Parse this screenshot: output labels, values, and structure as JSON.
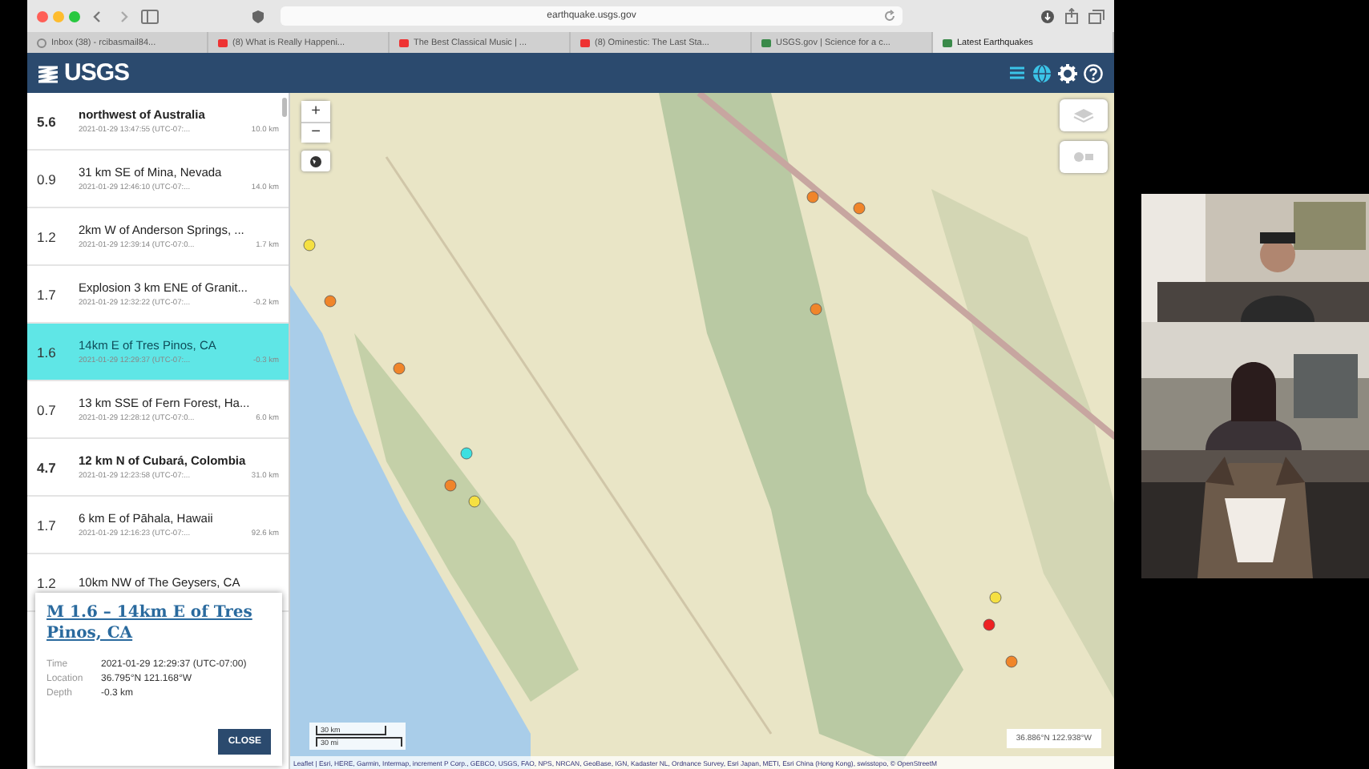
{
  "browser": {
    "address": "earthquake.usgs.gov",
    "tabs": [
      {
        "label": "Inbox (38) - rcibasmail84...",
        "selected": false
      },
      {
        "label": "(8) What is Really Happeni...",
        "selected": false
      },
      {
        "label": "The Best Classical Music | ...",
        "selected": false
      },
      {
        "label": "(8) Ominestic: The Last Sta...",
        "selected": false
      },
      {
        "label": "USGS.gov | Science for a c...",
        "selected": false
      },
      {
        "label": "Latest Earthquakes",
        "selected": true
      }
    ]
  },
  "header": {
    "logo": "USGS"
  },
  "earthquakes": [
    {
      "magnitude": "5.6",
      "title": "northwest of Australia",
      "time": "2021-01-29 13:47:55 (UTC-07:...",
      "depth": "10.0 km",
      "significant": true,
      "selected": false
    },
    {
      "magnitude": "0.9",
      "title": "31 km SE of Mina, Nevada",
      "time": "2021-01-29 12:46:10 (UTC-07:...",
      "depth": "14.0 km",
      "significant": false,
      "selected": false
    },
    {
      "magnitude": "1.2",
      "title": "2km W of Anderson Springs, ...",
      "time": "2021-01-29 12:39:14 (UTC-07:0...",
      "depth": "1.7 km",
      "significant": false,
      "selected": false
    },
    {
      "magnitude": "1.7",
      "title": "Explosion 3 km ENE of Granit...",
      "time": "2021-01-29 12:32:22 (UTC-07:...",
      "depth": "-0.2 km",
      "significant": false,
      "selected": false
    },
    {
      "magnitude": "1.6",
      "title": "14km E of Tres Pinos, CA",
      "time": "2021-01-29 12:29:37 (UTC-07:...",
      "depth": "-0.3 km",
      "significant": false,
      "selected": true
    },
    {
      "magnitude": "0.7",
      "title": "13 km SSE of Fern Forest, Ha...",
      "time": "2021-01-29 12:28:12 (UTC-07:0...",
      "depth": "6.0 km",
      "significant": false,
      "selected": false
    },
    {
      "magnitude": "4.7",
      "title": "12 km N of Cubará, Colombia",
      "time": "2021-01-29 12:23:58 (UTC-07:...",
      "depth": "31.0 km",
      "significant": true,
      "selected": false
    },
    {
      "magnitude": "1.7",
      "title": "6 km E of Pāhala, Hawaii",
      "time": "2021-01-29 12:16:23 (UTC-07:...",
      "depth": "92.6 km",
      "significant": false,
      "selected": false
    },
    {
      "magnitude": "1.2",
      "title": "10km NW of The Geysers, CA",
      "significant": false,
      "selected": false
    }
  ],
  "popup": {
    "title": "M 1.6 – 14km E of Tres Pinos, CA",
    "fields": [
      {
        "label": "Time",
        "value": "2021-01-29 12:29:37 (UTC-07:00)"
      },
      {
        "label": "Location",
        "value": "36.795°N 121.168°W"
      },
      {
        "label": "Depth",
        "value": "-0.3 km"
      }
    ],
    "button": "CLOSE"
  },
  "map": {
    "zoom_in": "+",
    "zoom_out": "−",
    "scale": [
      "30 km",
      "30 mi"
    ],
    "coordinates": "36.886°N 122.938°W",
    "attribution": "Leaflet | Esri, HERE, Garmin, Intermap, increment P Corp., GEBCO, USGS, FAO, NPS, NRCAN, GeoBase, IGN, Kadaster NL, Ordnance Survey, Esri Japan, METI, Esri China (Hong Kong), swisstopo, © OpenStreetM"
  }
}
